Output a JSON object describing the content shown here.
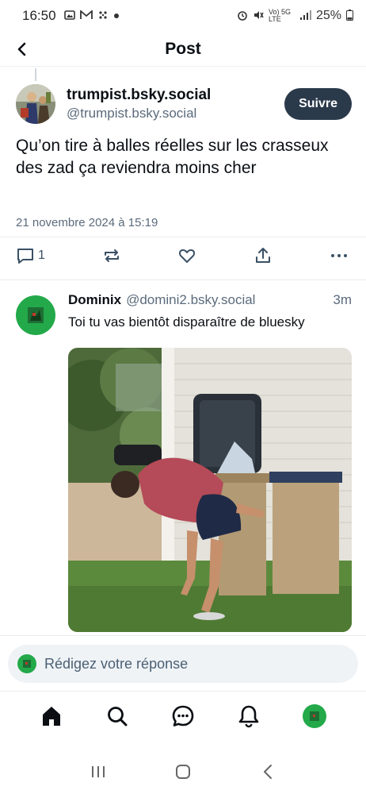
{
  "status_bar": {
    "time": "16:50",
    "network": "Vo) 5G LTE",
    "battery": "25%"
  },
  "header": {
    "title": "Post"
  },
  "post": {
    "author_name": "trumpist.bsky.social",
    "author_handle": "@trumpist.bsky.social",
    "follow_label": "Suivre",
    "text": "Qu’on tire à balles réelles sur les crasseux des zad ça reviendra moins cher",
    "date": "21 novembre 2024 à 15:19",
    "reply_count": "1"
  },
  "reply": {
    "name": "Dominix",
    "handle": "@domini2.bsky.social",
    "time": "3m",
    "text": "Toi tu vas bientôt disparaître de bluesky"
  },
  "compose": {
    "placeholder": "Rédigez votre réponse"
  },
  "icons": {
    "back": "chevron-left-icon",
    "reply": "comment-icon",
    "repost": "repost-icon",
    "like": "heart-icon",
    "share": "share-icon",
    "more": "more-icon",
    "home": "home-icon",
    "search": "search-icon",
    "chat": "chat-icon",
    "notifications": "bell-icon"
  },
  "colors": {
    "follow_button": "#2b3a4b",
    "accent_green": "#23a94a",
    "secondary_text": "#5b6b7c"
  }
}
